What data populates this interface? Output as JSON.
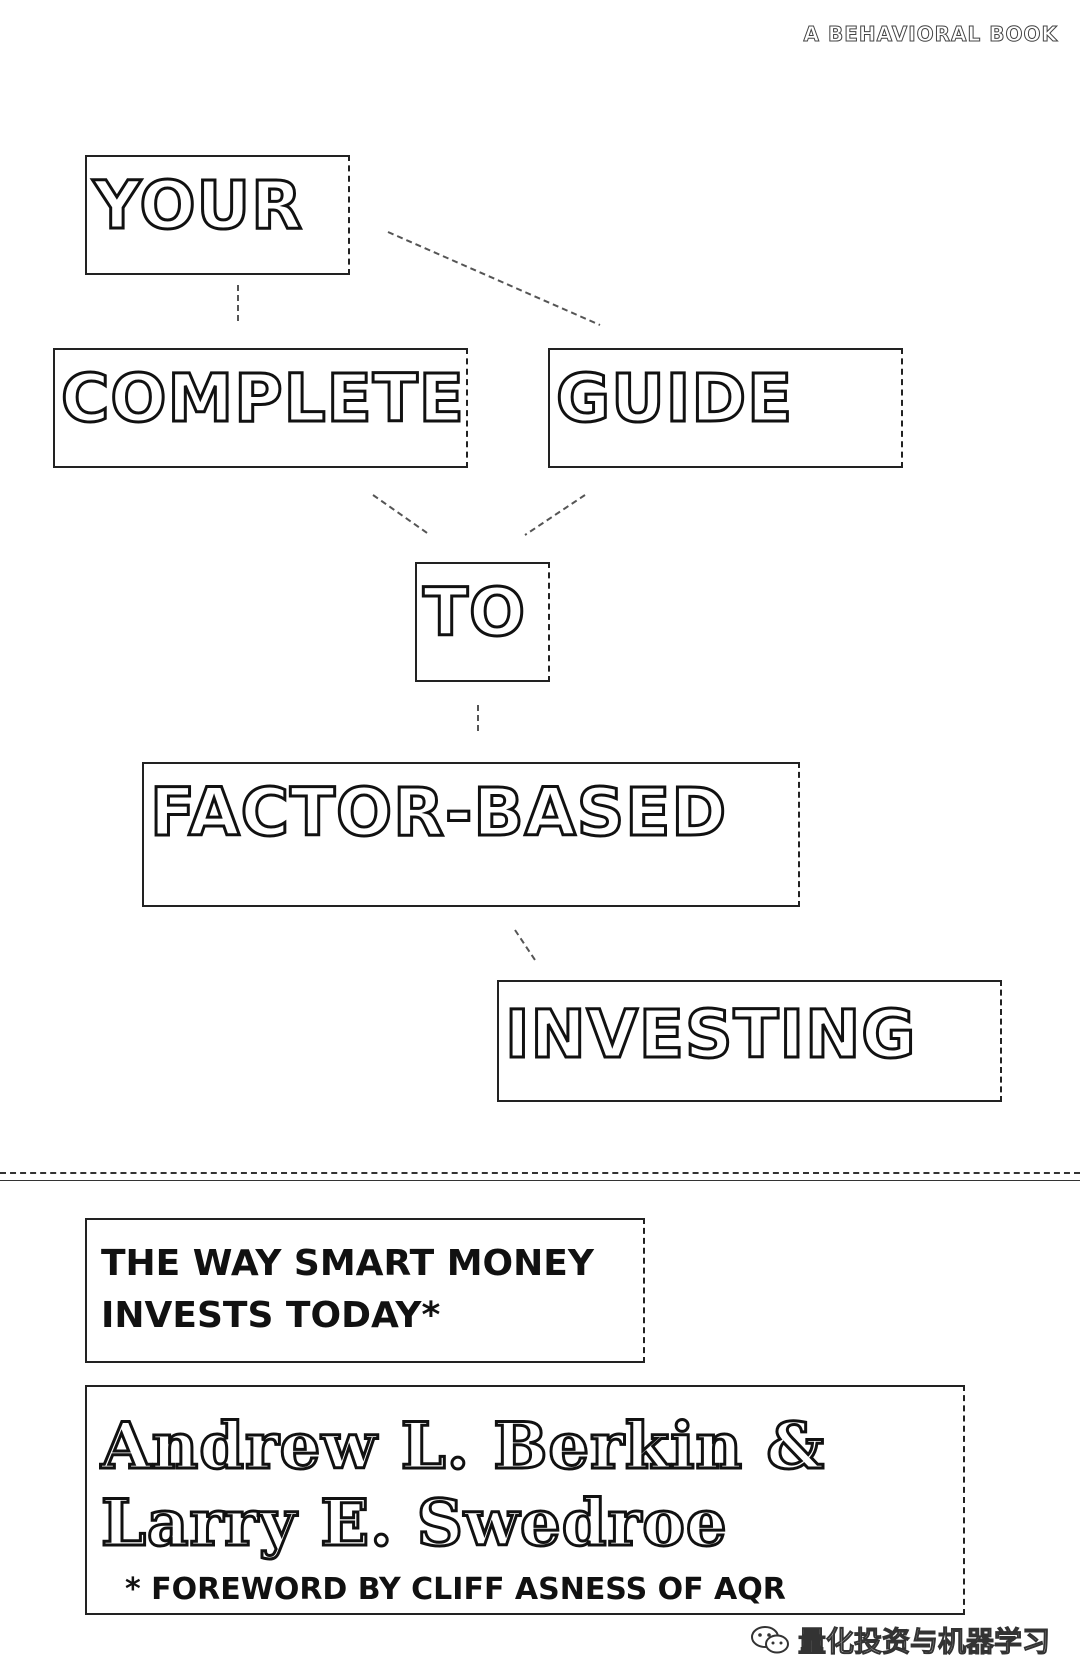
{
  "imprint": "A BEHAVIORAL BOOK",
  "title_words": {
    "your": "YOUR",
    "complete": "COMPLETE",
    "guide": "GUIDE",
    "to": "TO",
    "factor_based": "FACTOR-BASED",
    "investing": "INVESTING"
  },
  "subtitle": "THE WAY SMART MONEY INVESTS TODAY*",
  "authors": {
    "line1": "Andrew L. Berkin &",
    "line2": "Larry E. Swedroe"
  },
  "foreword": "* FOREWORD BY CLIFF ASNESS OF AQR",
  "watermark": "量化投资与机器学习",
  "icons": [
    "wechat-icon"
  ]
}
